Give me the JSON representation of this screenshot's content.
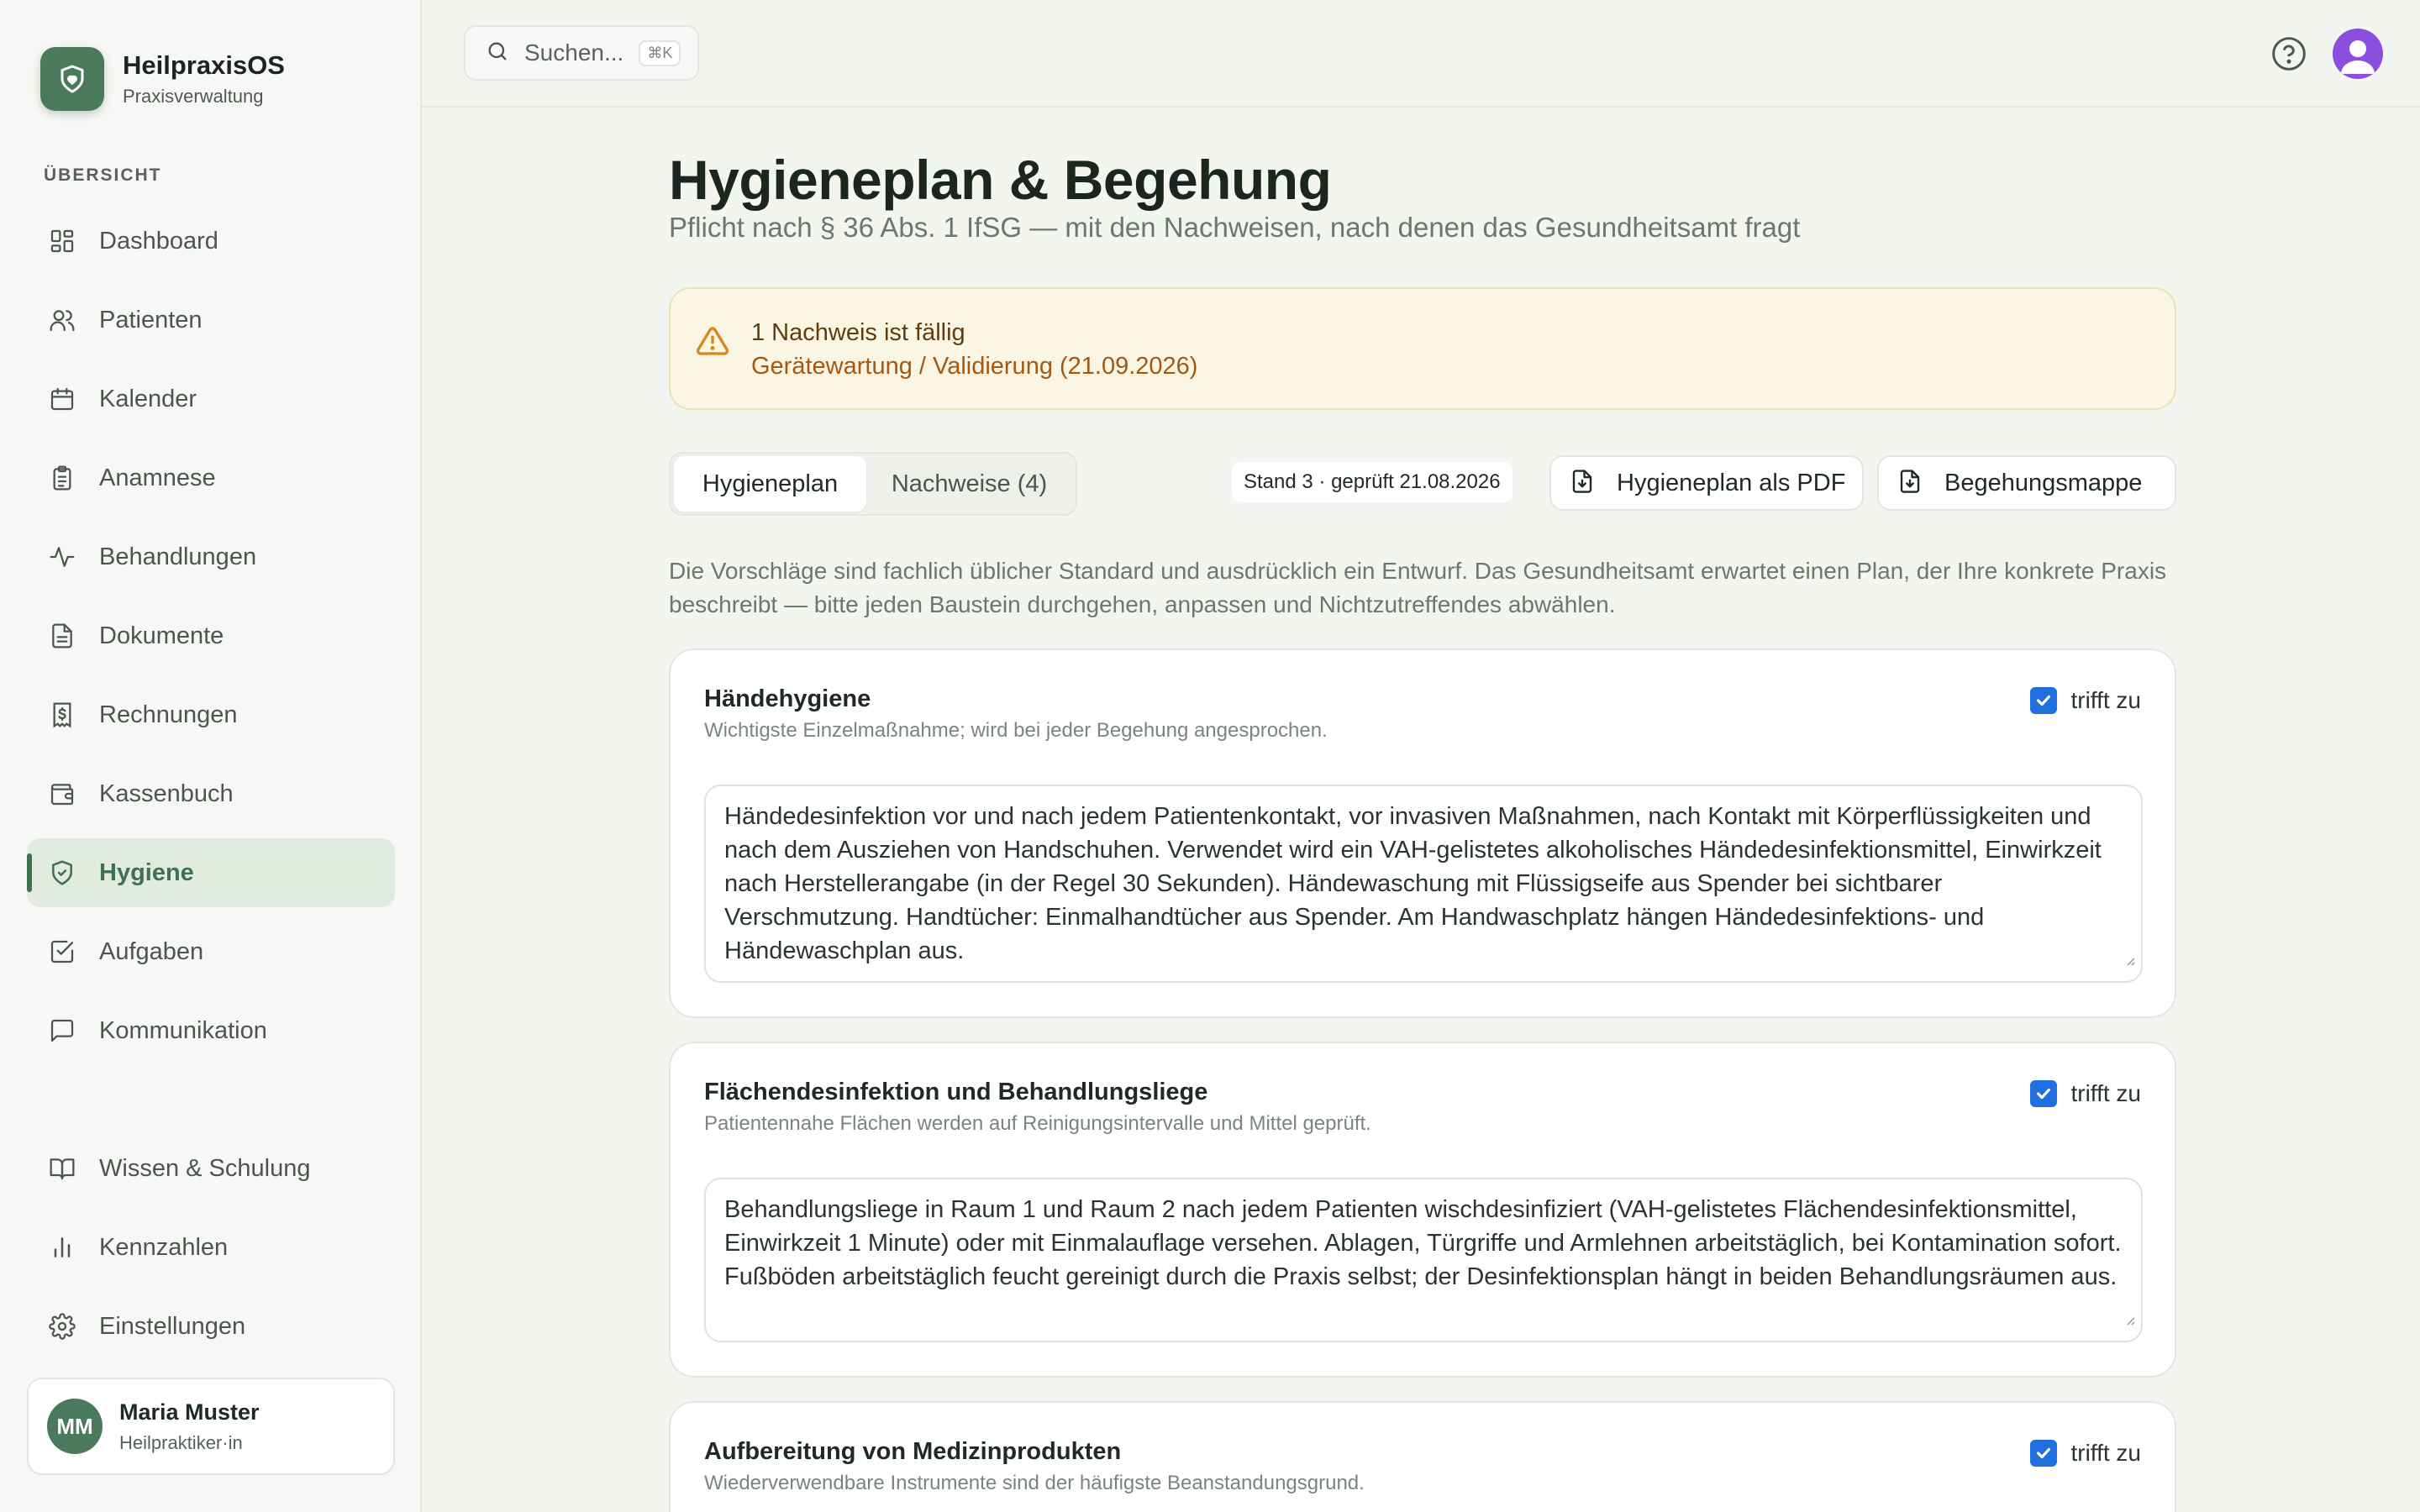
{
  "app": {
    "name": "HeilpraxisOS",
    "subtitle": "Praxisverwaltung"
  },
  "sidebar": {
    "section_label": "ÜBERSICHT",
    "items": [
      {
        "label": "Dashboard",
        "icon": "grid-icon"
      },
      {
        "label": "Patienten",
        "icon": "users-icon"
      },
      {
        "label": "Kalender",
        "icon": "calendar-icon"
      },
      {
        "label": "Anamnese",
        "icon": "clipboard-icon"
      },
      {
        "label": "Behandlungen",
        "icon": "activity-icon"
      },
      {
        "label": "Dokumente",
        "icon": "document-icon"
      },
      {
        "label": "Rechnungen",
        "icon": "receipt-icon"
      },
      {
        "label": "Kassenbuch",
        "icon": "wallet-icon"
      },
      {
        "label": "Hygiene",
        "icon": "shield-check-icon",
        "active": true
      },
      {
        "label": "Aufgaben",
        "icon": "checkbox-icon"
      },
      {
        "label": "Kommunikation",
        "icon": "message-icon"
      }
    ],
    "bottom_items": [
      {
        "label": "Wissen & Schulung",
        "icon": "book-icon"
      },
      {
        "label": "Kennzahlen",
        "icon": "bar-chart-icon"
      },
      {
        "label": "Einstellungen",
        "icon": "gear-icon"
      }
    ],
    "user": {
      "initials": "MM",
      "name": "Maria Muster",
      "role": "Heilpraktiker·in"
    }
  },
  "topbar": {
    "search_placeholder": "Suchen...",
    "search_shortcut": "⌘K"
  },
  "page": {
    "title": "Hygieneplan & Begehung",
    "subtitle": "Pflicht nach § 36 Abs. 1 IfSG — mit den Nachweisen, nach denen das Gesundheitsamt fragt"
  },
  "alert": {
    "title": "1 Nachweis ist fällig",
    "detail": "Gerätewartung / Validierung (21.09.2026)"
  },
  "tabs": [
    {
      "label": "Hygieneplan",
      "active": true
    },
    {
      "label": "Nachweise (4)",
      "active": false
    }
  ],
  "toolbar": {
    "stand_badge": "Stand 3 · geprüft 21.08.2026",
    "pdf_button": "Hygieneplan als PDF",
    "mappe_button": "Begehungsmappe"
  },
  "intro_text": "Die Vorschläge sind fachlich üblicher Standard und ausdrücklich ein Entwurf. Das Gesundheitsamt erwartet einen Plan, der Ihre konkrete Praxis beschreibt — bitte jeden Baustein durchgehen, anpassen und Nichtzutreffendes abwählen.",
  "sections": [
    {
      "title": "Händehygiene",
      "description": "Wichtigste Einzelmaßnahme; wird bei jeder Begehung angesprochen.",
      "check_label": "trifft zu",
      "checked": true,
      "text": "Händedesinfektion vor und nach jedem Patientenkontakt, vor invasiven Maßnahmen, nach Kontakt mit Körperflüssigkeiten und nach dem Ausziehen von Handschuhen. Verwendet wird ein VAH-gelistetes alkoholisches Händedesinfektionsmittel, Einwirkzeit nach Herstellerangabe (in der Regel 30 Sekunden). Händewaschung mit Flüssigseife aus Spender bei sichtbarer Verschmutzung. Handtücher: Einmalhandtücher aus Spender. Am Handwaschplatz hängen Händedesinfektions- und Händewaschplan aus."
    },
    {
      "title": "Flächendesinfektion und Behandlungsliege",
      "description": "Patientennahe Flächen werden auf Reinigungsintervalle und Mittel geprüft.",
      "check_label": "trifft zu",
      "checked": true,
      "text": "Behandlungsliege in Raum 1 und Raum 2 nach jedem Patienten wischdesinfiziert (VAH-gelistetes Flächendesinfektionsmittel, Einwirkzeit 1 Minute) oder mit Einmalauflage versehen. Ablagen, Türgriffe und Armlehnen arbeitstäglich, bei Kontamination sofort. Fußböden arbeitstäglich feucht gereinigt durch die Praxis selbst; der Desinfektionsplan hängt in beiden Behandlungsräumen aus."
    },
    {
      "title": "Aufbereitung von Medizinprodukten",
      "description": "Wiederverwendbare Instrumente sind der häufigste Beanstandungsgrund.",
      "check_label": "trifft zu",
      "checked": true,
      "text": ""
    }
  ],
  "colors": {
    "accent": "#3f7150",
    "brand": "#4a7a5b",
    "checkbox": "#1f6fe0",
    "warning": "#a5580e"
  }
}
